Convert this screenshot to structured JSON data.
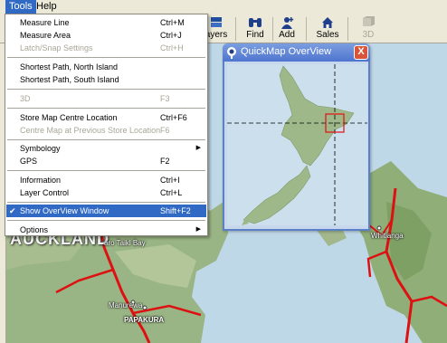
{
  "menubar": {
    "items": [
      {
        "label": "Tools"
      },
      {
        "label": "Help"
      }
    ]
  },
  "toolbar": {
    "buttons": [
      {
        "label": "ayers",
        "icon": "layers-icon"
      },
      {
        "label": "Find",
        "icon": "binoculars-icon"
      },
      {
        "label": "Add",
        "icon": "add-person-icon"
      },
      {
        "label": "Sales",
        "icon": "house-icon"
      },
      {
        "label": "3D",
        "icon": "3d-icon",
        "disabled": true
      }
    ]
  },
  "tools_menu": {
    "items": [
      {
        "label": "Measure Line",
        "shortcut": "Ctrl+M"
      },
      {
        "label": "Measure Area",
        "shortcut": "Ctrl+J"
      },
      {
        "label": "Latch/Snap Settings",
        "shortcut": "Ctrl+H",
        "disabled": true
      },
      {
        "label": "Shortest Path, North Island",
        "shortcut": ""
      },
      {
        "label": "Shortest Path, South Island",
        "shortcut": ""
      },
      {
        "label": "3D",
        "shortcut": "F3",
        "disabled": true
      },
      {
        "label": "Store Map Centre Location",
        "shortcut": "Ctrl+F6"
      },
      {
        "label": "Centre Map at Previous Store Location",
        "shortcut": "F6",
        "disabled": true
      },
      {
        "label": "Symbology",
        "shortcut": "",
        "submenu": true
      },
      {
        "label": "GPS",
        "shortcut": "F2"
      },
      {
        "label": "Information",
        "shortcut": "Ctrl+I"
      },
      {
        "label": "Layer Control",
        "shortcut": "Ctrl+L"
      },
      {
        "label": "Show OverView Window",
        "shortcut": "Shift+F2",
        "checked": true,
        "selected": true
      },
      {
        "label": "Options",
        "shortcut": "",
        "submenu": true
      }
    ]
  },
  "overview_window": {
    "title": "QuickMap OverView",
    "close_glyph": "X"
  },
  "map": {
    "labels": {
      "auckland": "AUCKLAND",
      "bay": "aro Taikl Bay",
      "manurewa": "Manurewa",
      "papakura": "PAPAKURA",
      "whitianga": "Whitianga"
    }
  },
  "colors": {
    "menu_highlight": "#316ac5",
    "sea": "#bfd8e8",
    "land": "#9ab585",
    "road": "#dd1111",
    "window_title": "#5b80c8"
  }
}
